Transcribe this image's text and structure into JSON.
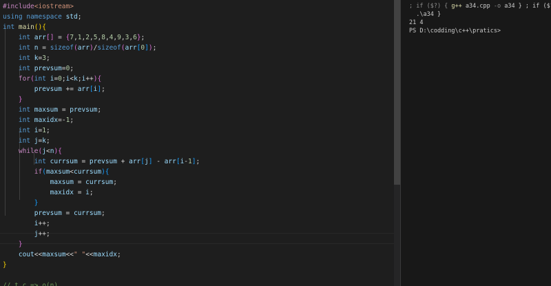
{
  "editor": {
    "lines": [
      {
        "id": "l1",
        "parts": [
          {
            "c": "pp",
            "t": "#include"
          },
          {
            "c": "inc",
            "t": "<iostream>"
          }
        ]
      },
      {
        "id": "l2",
        "parts": [
          {
            "c": "kw",
            "t": "using"
          },
          {
            "c": "",
            "t": " "
          },
          {
            "c": "kw",
            "t": "namespace"
          },
          {
            "c": "",
            "t": " "
          },
          {
            "c": "var",
            "t": "std"
          },
          {
            "c": "",
            "t": ";"
          }
        ]
      },
      {
        "id": "l3",
        "parts": [
          {
            "c": "ty",
            "t": "int"
          },
          {
            "c": "",
            "t": " "
          },
          {
            "c": "fn",
            "t": "main"
          },
          {
            "c": "br1",
            "t": "()"
          },
          {
            "c": "br1",
            "t": "{"
          }
        ]
      },
      {
        "id": "l4",
        "parts": [
          {
            "c": "",
            "t": "    "
          },
          {
            "c": "ty",
            "t": "int"
          },
          {
            "c": "",
            "t": " "
          },
          {
            "c": "var",
            "t": "arr"
          },
          {
            "c": "br2",
            "t": "[]"
          },
          {
            "c": "",
            "t": " = "
          },
          {
            "c": "br2",
            "t": "{"
          },
          {
            "c": "num",
            "t": "7"
          },
          {
            "c": "",
            "t": ","
          },
          {
            "c": "num",
            "t": "1"
          },
          {
            "c": "",
            "t": ","
          },
          {
            "c": "num",
            "t": "2"
          },
          {
            "c": "",
            "t": ","
          },
          {
            "c": "num",
            "t": "5"
          },
          {
            "c": "",
            "t": ","
          },
          {
            "c": "num",
            "t": "8"
          },
          {
            "c": "",
            "t": ","
          },
          {
            "c": "num",
            "t": "4"
          },
          {
            "c": "",
            "t": ","
          },
          {
            "c": "num",
            "t": "9"
          },
          {
            "c": "",
            "t": ","
          },
          {
            "c": "num",
            "t": "3"
          },
          {
            "c": "",
            "t": ","
          },
          {
            "c": "num",
            "t": "6"
          },
          {
            "c": "br2",
            "t": "}"
          },
          {
            "c": "",
            "t": ";"
          }
        ]
      },
      {
        "id": "l5",
        "parts": [
          {
            "c": "",
            "t": "    "
          },
          {
            "c": "ty",
            "t": "int"
          },
          {
            "c": "",
            "t": " "
          },
          {
            "c": "var",
            "t": "n"
          },
          {
            "c": "",
            "t": " = "
          },
          {
            "c": "kw",
            "t": "sizeof"
          },
          {
            "c": "br2",
            "t": "("
          },
          {
            "c": "var",
            "t": "arr"
          },
          {
            "c": "br2",
            "t": ")"
          },
          {
            "c": "",
            "t": "/"
          },
          {
            "c": "kw",
            "t": "sizeof"
          },
          {
            "c": "br2",
            "t": "("
          },
          {
            "c": "var",
            "t": "arr"
          },
          {
            "c": "br3",
            "t": "["
          },
          {
            "c": "num",
            "t": "0"
          },
          {
            "c": "br3",
            "t": "]"
          },
          {
            "c": "br2",
            "t": ")"
          },
          {
            "c": "",
            "t": ";"
          }
        ]
      },
      {
        "id": "l6",
        "parts": [
          {
            "c": "",
            "t": "    "
          },
          {
            "c": "ty",
            "t": "int"
          },
          {
            "c": "",
            "t": " "
          },
          {
            "c": "var",
            "t": "k"
          },
          {
            "c": "",
            "t": "="
          },
          {
            "c": "num",
            "t": "3"
          },
          {
            "c": "",
            "t": ";"
          }
        ]
      },
      {
        "id": "l7",
        "parts": [
          {
            "c": "",
            "t": "    "
          },
          {
            "c": "ty",
            "t": "int"
          },
          {
            "c": "",
            "t": " "
          },
          {
            "c": "var",
            "t": "prevsum"
          },
          {
            "c": "",
            "t": "="
          },
          {
            "c": "num",
            "t": "0"
          },
          {
            "c": "",
            "t": ";"
          }
        ]
      },
      {
        "id": "l8",
        "parts": [
          {
            "c": "",
            "t": "    "
          },
          {
            "c": "ctl",
            "t": "for"
          },
          {
            "c": "br2",
            "t": "("
          },
          {
            "c": "ty",
            "t": "int"
          },
          {
            "c": "",
            "t": " "
          },
          {
            "c": "var",
            "t": "i"
          },
          {
            "c": "",
            "t": "="
          },
          {
            "c": "num",
            "t": "0"
          },
          {
            "c": "",
            "t": ";"
          },
          {
            "c": "var",
            "t": "i"
          },
          {
            "c": "",
            "t": "<"
          },
          {
            "c": "var",
            "t": "k"
          },
          {
            "c": "",
            "t": ";"
          },
          {
            "c": "var",
            "t": "i"
          },
          {
            "c": "",
            "t": "++"
          },
          {
            "c": "br2",
            "t": ")"
          },
          {
            "c": "br2",
            "t": "{"
          }
        ]
      },
      {
        "id": "l9",
        "parts": [
          {
            "c": "",
            "t": "        "
          },
          {
            "c": "var",
            "t": "prevsum"
          },
          {
            "c": "",
            "t": " += "
          },
          {
            "c": "var",
            "t": "arr"
          },
          {
            "c": "br3",
            "t": "["
          },
          {
            "c": "var",
            "t": "i"
          },
          {
            "c": "br3",
            "t": "]"
          },
          {
            "c": "",
            "t": ";"
          }
        ]
      },
      {
        "id": "l10",
        "parts": [
          {
            "c": "",
            "t": "    "
          },
          {
            "c": "br2",
            "t": "}"
          }
        ]
      },
      {
        "id": "l11",
        "parts": [
          {
            "c": "",
            "t": "    "
          },
          {
            "c": "ty",
            "t": "int"
          },
          {
            "c": "",
            "t": " "
          },
          {
            "c": "var",
            "t": "maxsum"
          },
          {
            "c": "",
            "t": " = "
          },
          {
            "c": "var",
            "t": "prevsum"
          },
          {
            "c": "",
            "t": ";"
          }
        ]
      },
      {
        "id": "l12",
        "parts": [
          {
            "c": "",
            "t": "    "
          },
          {
            "c": "ty",
            "t": "int"
          },
          {
            "c": "",
            "t": " "
          },
          {
            "c": "var",
            "t": "maxidx"
          },
          {
            "c": "",
            "t": "=-"
          },
          {
            "c": "num",
            "t": "1"
          },
          {
            "c": "",
            "t": ";"
          }
        ]
      },
      {
        "id": "l13",
        "parts": [
          {
            "c": "",
            "t": "    "
          },
          {
            "c": "ty",
            "t": "int"
          },
          {
            "c": "",
            "t": " "
          },
          {
            "c": "var",
            "t": "i"
          },
          {
            "c": "",
            "t": "="
          },
          {
            "c": "num",
            "t": "1"
          },
          {
            "c": "",
            "t": ";"
          }
        ]
      },
      {
        "id": "l14",
        "parts": [
          {
            "c": "",
            "t": "    "
          },
          {
            "c": "ty",
            "t": "int"
          },
          {
            "c": "",
            "t": " "
          },
          {
            "c": "var",
            "t": "j"
          },
          {
            "c": "",
            "t": "="
          },
          {
            "c": "var",
            "t": "k"
          },
          {
            "c": "",
            "t": ";"
          }
        ]
      },
      {
        "id": "l15",
        "parts": [
          {
            "c": "",
            "t": "    "
          },
          {
            "c": "ctl",
            "t": "while"
          },
          {
            "c": "br2",
            "t": "("
          },
          {
            "c": "var",
            "t": "j"
          },
          {
            "c": "",
            "t": "<"
          },
          {
            "c": "var",
            "t": "n"
          },
          {
            "c": "br2",
            "t": ")"
          },
          {
            "c": "br2",
            "t": "{"
          }
        ]
      },
      {
        "id": "l16",
        "parts": [
          {
            "c": "",
            "t": "        "
          },
          {
            "c": "ty",
            "t": "int"
          },
          {
            "c": "",
            "t": " "
          },
          {
            "c": "var",
            "t": "currsum"
          },
          {
            "c": "",
            "t": " = "
          },
          {
            "c": "var",
            "t": "prevsum"
          },
          {
            "c": "",
            "t": " + "
          },
          {
            "c": "var",
            "t": "arr"
          },
          {
            "c": "br3",
            "t": "["
          },
          {
            "c": "var",
            "t": "j"
          },
          {
            "c": "br3",
            "t": "]"
          },
          {
            "c": "",
            "t": " - "
          },
          {
            "c": "var",
            "t": "arr"
          },
          {
            "c": "br3",
            "t": "["
          },
          {
            "c": "var",
            "t": "i"
          },
          {
            "c": "",
            "t": "-"
          },
          {
            "c": "num",
            "t": "1"
          },
          {
            "c": "br3",
            "t": "]"
          },
          {
            "c": "",
            "t": ";"
          }
        ]
      },
      {
        "id": "l17",
        "parts": [
          {
            "c": "",
            "t": "        "
          },
          {
            "c": "ctl",
            "t": "if"
          },
          {
            "c": "br3",
            "t": "("
          },
          {
            "c": "var",
            "t": "maxsum"
          },
          {
            "c": "",
            "t": "<"
          },
          {
            "c": "var",
            "t": "currsum"
          },
          {
            "c": "br3",
            "t": ")"
          },
          {
            "c": "br3",
            "t": "{"
          }
        ]
      },
      {
        "id": "l18",
        "parts": [
          {
            "c": "",
            "t": "            "
          },
          {
            "c": "var",
            "t": "maxsum"
          },
          {
            "c": "",
            "t": " = "
          },
          {
            "c": "var",
            "t": "currsum"
          },
          {
            "c": "",
            "t": ";"
          }
        ]
      },
      {
        "id": "l19",
        "parts": [
          {
            "c": "",
            "t": "            "
          },
          {
            "c": "var",
            "t": "maxidx"
          },
          {
            "c": "",
            "t": " = "
          },
          {
            "c": "var",
            "t": "i"
          },
          {
            "c": "",
            "t": ";"
          }
        ]
      },
      {
        "id": "l20",
        "parts": [
          {
            "c": "",
            "t": "        "
          },
          {
            "c": "br3",
            "t": "}"
          }
        ]
      },
      {
        "id": "l21",
        "parts": [
          {
            "c": "",
            "t": "        "
          },
          {
            "c": "var",
            "t": "prevsum"
          },
          {
            "c": "",
            "t": " = "
          },
          {
            "c": "var",
            "t": "currsum"
          },
          {
            "c": "",
            "t": ";"
          }
        ]
      },
      {
        "id": "l22",
        "parts": [
          {
            "c": "",
            "t": "        "
          },
          {
            "c": "var",
            "t": "i"
          },
          {
            "c": "",
            "t": "++;"
          }
        ]
      },
      {
        "id": "l23",
        "parts": [
          {
            "c": "",
            "t": "        "
          },
          {
            "c": "var",
            "t": "j"
          },
          {
            "c": "",
            "t": "++;"
          }
        ]
      },
      {
        "id": "l24",
        "parts": [
          {
            "c": "",
            "t": "    "
          },
          {
            "c": "br2",
            "t": "}"
          }
        ]
      },
      {
        "id": "l25",
        "parts": [
          {
            "c": "",
            "t": "    "
          },
          {
            "c": "var",
            "t": "cout"
          },
          {
            "c": "",
            "t": "<<"
          },
          {
            "c": "var",
            "t": "maxsum"
          },
          {
            "c": "",
            "t": "<<"
          },
          {
            "c": "str",
            "t": "\" \""
          },
          {
            "c": "",
            "t": "<<"
          },
          {
            "c": "var",
            "t": "maxidx"
          },
          {
            "c": "",
            "t": ";"
          }
        ]
      },
      {
        "id": "l26",
        "parts": [
          {
            "c": "br1",
            "t": "}"
          }
        ]
      },
      {
        "id": "l27",
        "parts": [
          {
            "c": "",
            "t": ""
          }
        ]
      },
      {
        "id": "l28",
        "parts": [
          {
            "c": "cm",
            "t": "// t.c => o(n)"
          }
        ]
      }
    ]
  },
  "terminal": {
    "lines": [
      {
        "id": "t1",
        "parts": [
          {
            "c": "tmuted",
            "t": "; if ($?) { "
          },
          {
            "c": "tyellow",
            "t": "g++"
          },
          {
            "c": "",
            "t": " a34.cpp "
          },
          {
            "c": "tmuted",
            "t": "-o"
          },
          {
            "c": "",
            "t": " a34 } ; if ($?)"
          }
        ]
      },
      {
        "id": "t2",
        "parts": [
          {
            "c": "",
            "t": "  .\\a34 }"
          }
        ]
      },
      {
        "id": "t3",
        "parts": [
          {
            "c": "",
            "t": "21 4"
          }
        ]
      },
      {
        "id": "t4",
        "parts": [
          {
            "c": "",
            "t": "PS D:\\codding\\c++\\pratics>"
          }
        ]
      }
    ]
  }
}
